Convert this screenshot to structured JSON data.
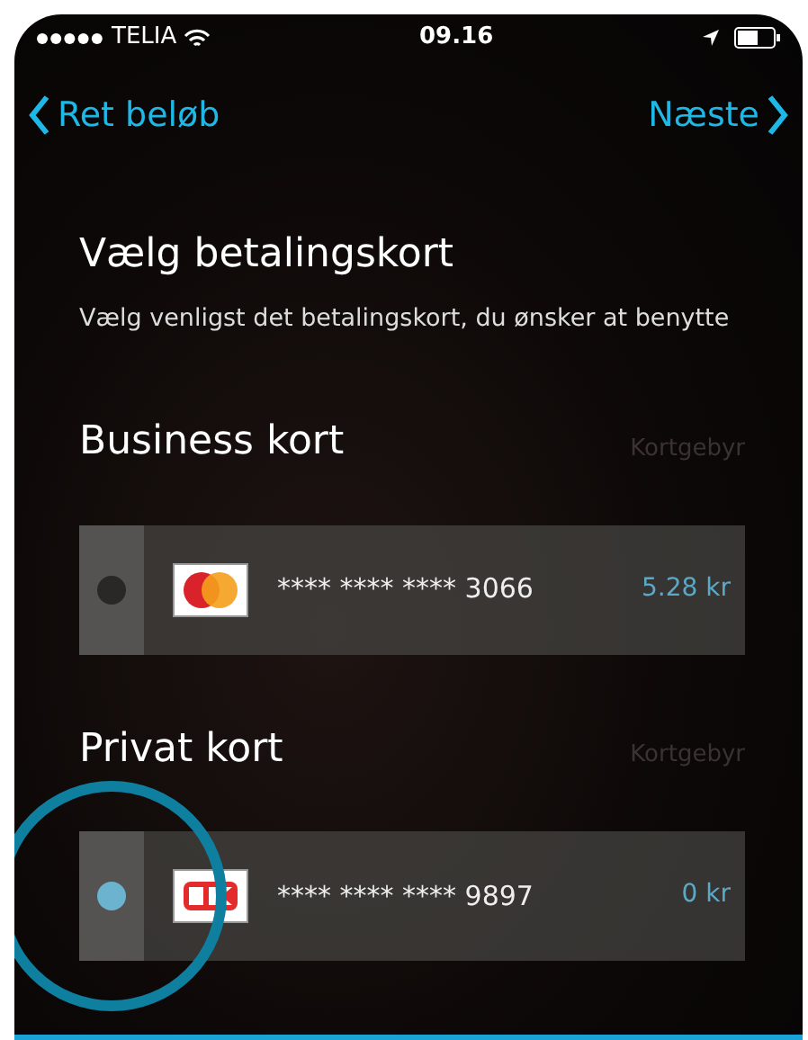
{
  "status_bar": {
    "carrier": "TELIA",
    "time": "09.16"
  },
  "nav": {
    "back": "Ret beløb",
    "next": "Næste"
  },
  "title": "Vælg betalingskort",
  "subtitle": "Vælg venligst det betalingskort, du ønsker at benytte",
  "sections": [
    {
      "title": "Business kort",
      "fee_label": "Kortgebyr",
      "cards": [
        {
          "kind": "mastercard",
          "number": "**** **** **** 3066",
          "fee": "5.28 kr",
          "selected": false
        }
      ]
    },
    {
      "title": "Privat kort",
      "fee_label": "Kortgebyr",
      "cards": [
        {
          "kind": "dankort",
          "number": "**** **** **** 9897",
          "fee": "0 kr",
          "selected": true
        }
      ]
    }
  ]
}
